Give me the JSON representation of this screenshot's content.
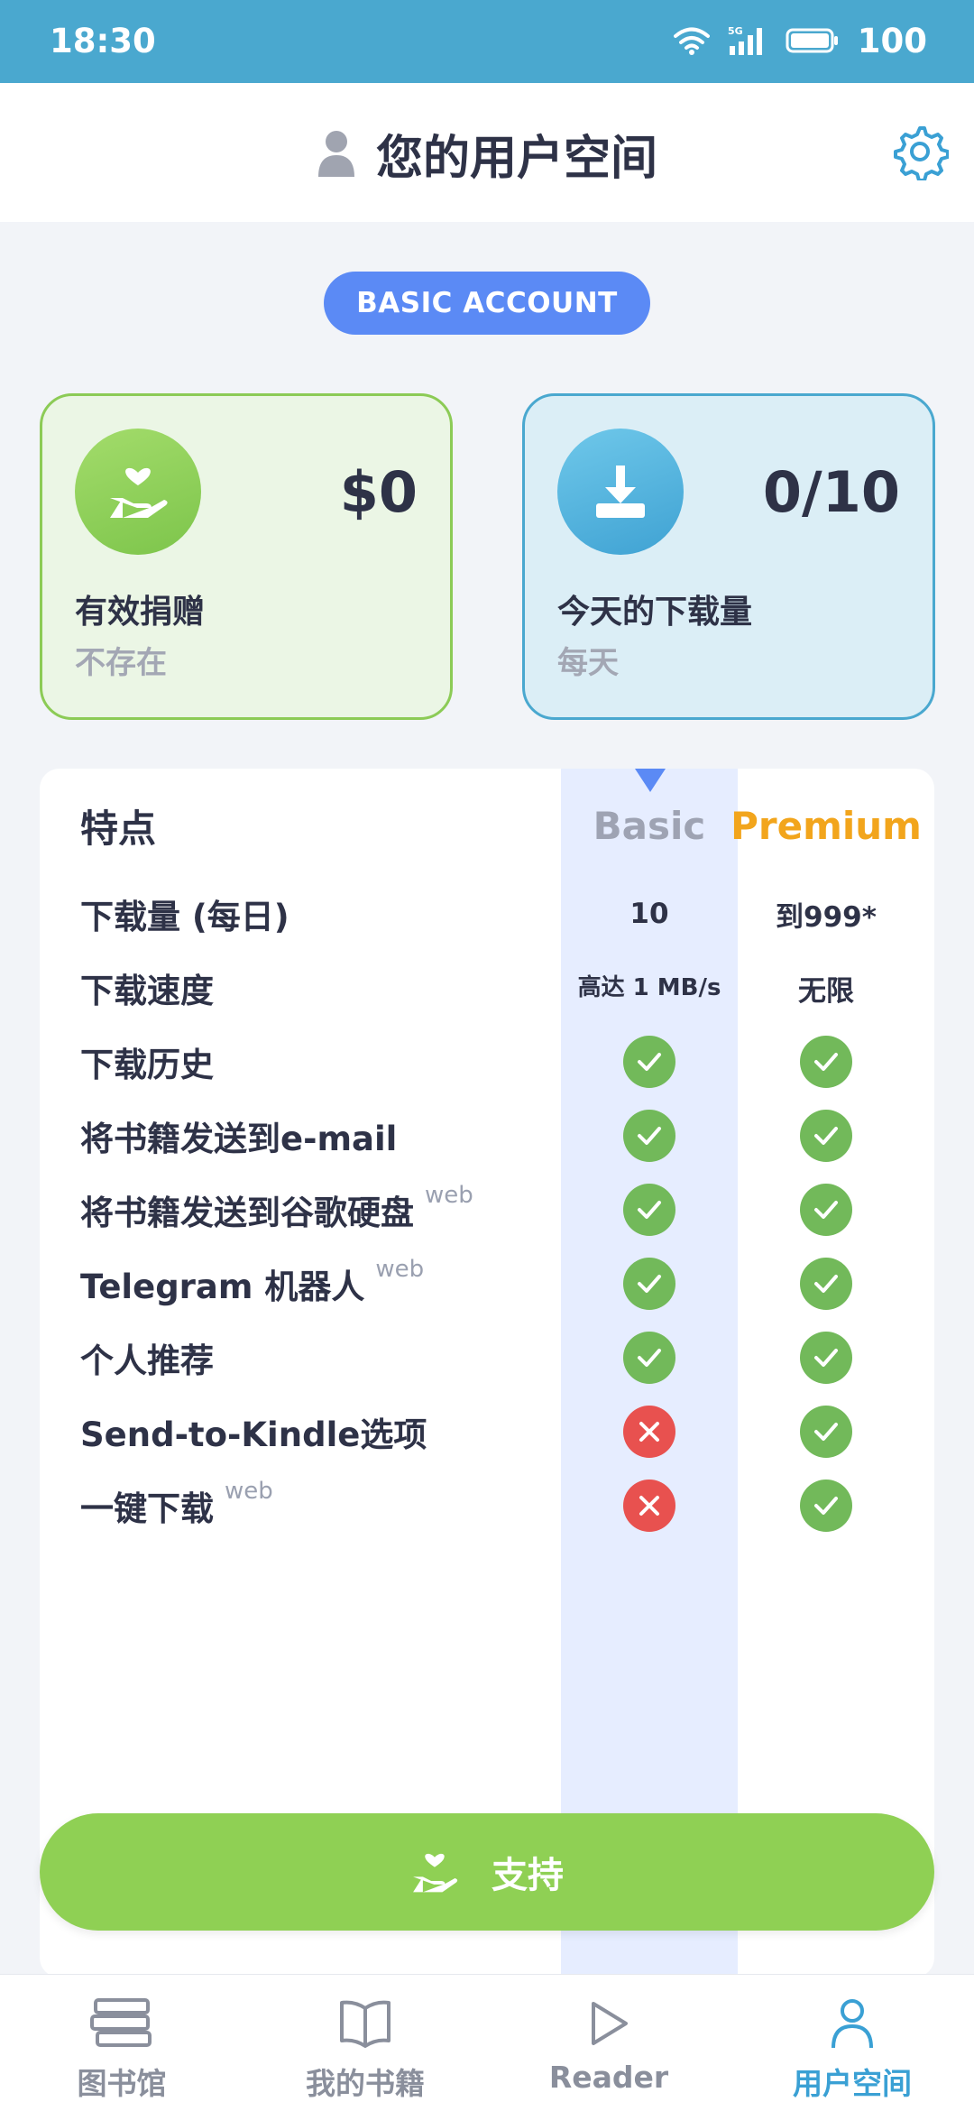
{
  "status_bar": {
    "time": "18:30",
    "battery": "100",
    "network": "5G"
  },
  "header": {
    "title": "您的用户空间",
    "user_icon": "user-icon",
    "settings_icon": "gear-icon"
  },
  "badge": "BASIC ACCOUNT",
  "cards": {
    "donation": {
      "amount": "$0",
      "label": "有效捐赠",
      "sub": "不存在",
      "icon": "heart-hand-icon"
    },
    "downloads": {
      "amount": "0/10",
      "label": "今天的下载量",
      "sub": "每天",
      "icon": "download-icon"
    }
  },
  "table": {
    "header": {
      "feature": "特点",
      "basic": "Basic",
      "premium": "Premium"
    },
    "rows": [
      {
        "name": "下载量 (每日)",
        "sup": "",
        "basic": "10",
        "premium": "到999*"
      },
      {
        "name": "下载速度",
        "sup": "",
        "basic": "高达 1 MB/s",
        "premium": "无限"
      },
      {
        "name": "下载历史",
        "sup": "",
        "basic": "check",
        "premium": "check"
      },
      {
        "name": "将书籍发送到e-mail",
        "sup": "",
        "basic": "check",
        "premium": "check"
      },
      {
        "name": "将书籍发送到谷歌硬盘",
        "sup": "web",
        "basic": "check",
        "premium": "check"
      },
      {
        "name": "Telegram 机器人",
        "sup": "web",
        "basic": "check",
        "premium": "check"
      },
      {
        "name": "个人推荐",
        "sup": "",
        "basic": "check",
        "premium": "check"
      },
      {
        "name": "Send-to-Kindle选项",
        "sup": "",
        "basic": "cross",
        "premium": "check"
      },
      {
        "name": "一键下载",
        "sup": "web",
        "basic": "cross",
        "premium": "check"
      }
    ]
  },
  "support_button": {
    "label": "支持",
    "icon": "heart-hand-icon"
  },
  "bottom_nav": [
    {
      "label": "图书馆",
      "icon": "library-icon",
      "active": false
    },
    {
      "label": "我的书籍",
      "icon": "book-icon",
      "active": false
    },
    {
      "label": "Reader",
      "icon": "play-icon",
      "active": false
    },
    {
      "label": "用户空间",
      "icon": "user-icon",
      "active": true
    }
  ],
  "colors": {
    "status_bar": "#4aa8cf",
    "accent_blue": "#5b8af5",
    "green": "#8fd054",
    "premium": "#f2a51c",
    "active_nav": "#3aa0d4"
  }
}
